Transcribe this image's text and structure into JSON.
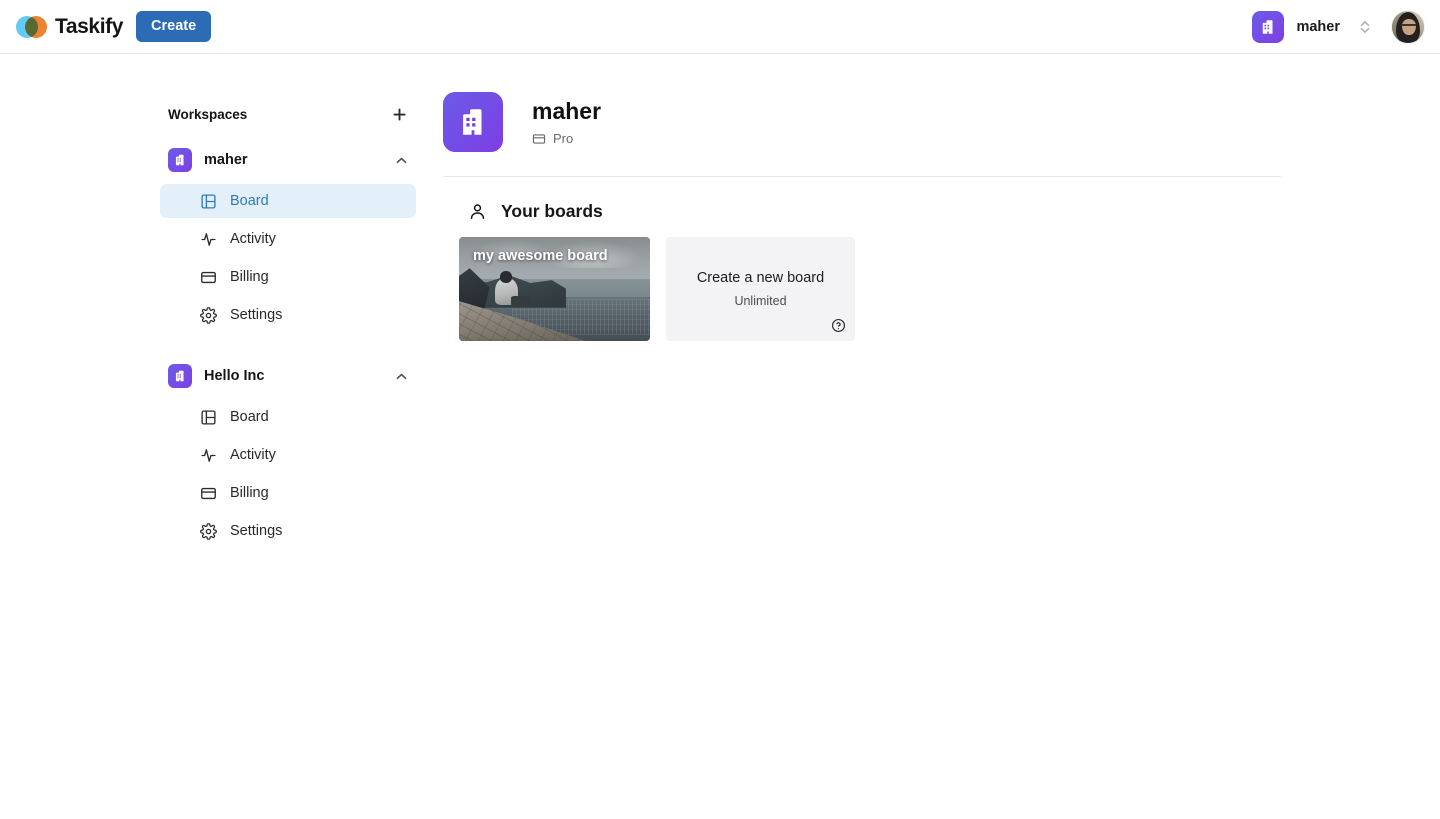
{
  "app": {
    "brand_name": "Taskify",
    "logo_colors": {
      "left_circle": "#61cbf4",
      "right_circle": "#ec8333",
      "overlap": "#5c3a22"
    },
    "accent_blue": "#2b6cb4",
    "active_item_bg": "#e3f0fa",
    "active_item_fg": "#3079bb",
    "org_gradient_from": "#6d5ce7",
    "org_gradient_to": "#7c3fe4"
  },
  "topnav": {
    "create_label": "Create",
    "org_name": "maher",
    "org_icon": "building-icon",
    "select_icon": "chevron-up-down-icon",
    "avatar_icon": "user-avatar"
  },
  "sidebar": {
    "title": "Workspaces",
    "add_icon": "plus-icon",
    "workspaces": [
      {
        "name": "maher",
        "icon": "building-icon",
        "toggle_icon": "chevron-up-icon",
        "expanded": true,
        "items": [
          {
            "label": "Board",
            "icon": "layout-board-icon",
            "active": true
          },
          {
            "label": "Activity",
            "icon": "activity-pulse-icon",
            "active": false
          },
          {
            "label": "Billing",
            "icon": "credit-card-icon",
            "active": false
          },
          {
            "label": "Settings",
            "icon": "gear-icon",
            "active": false
          }
        ]
      },
      {
        "name": "Hello Inc",
        "icon": "building-icon",
        "toggle_icon": "chevron-up-icon",
        "expanded": true,
        "items": [
          {
            "label": "Board",
            "icon": "layout-board-icon",
            "active": false
          },
          {
            "label": "Activity",
            "icon": "activity-pulse-icon",
            "active": false
          },
          {
            "label": "Billing",
            "icon": "credit-card-icon",
            "active": false
          },
          {
            "label": "Settings",
            "icon": "gear-icon",
            "active": false
          }
        ]
      }
    ]
  },
  "main": {
    "org_title": "maher",
    "org_plan": "Pro",
    "org_plan_icon": "credit-card-icon",
    "org_icon": "building-icon",
    "boards_heading": "Your boards",
    "boards_heading_icon": "user-icon",
    "boards": [
      {
        "title": "my awesome board",
        "image": "mountain-city-overlook-photo"
      }
    ],
    "create_board": {
      "title": "Create a new board",
      "subtitle": "Unlimited",
      "help_icon": "help-circle-icon"
    }
  }
}
